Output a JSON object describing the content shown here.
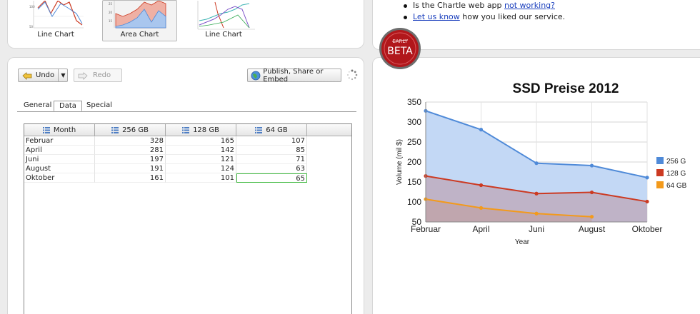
{
  "thumbnails": [
    {
      "label": "Line Chart",
      "selected": false
    },
    {
      "label": "Area Chart",
      "selected": true
    },
    {
      "label": "Line Chart",
      "selected": false
    }
  ],
  "info": {
    "line1_prefix": "Is the Chartle web app ",
    "line1_link": "not working?",
    "line2_link": "Let us know",
    "line2_suffix": " how you liked our service."
  },
  "badge": {
    "top": "EARLY",
    "main": "BETA"
  },
  "toolbar": {
    "undo_label": "Undo",
    "redo_label": "Redo",
    "publish_label": "Publish, Share or Embed",
    "undo_icon": "undo-arrow-icon",
    "redo_icon": "redo-arrow-icon",
    "publish_icon": "globe-icon",
    "spinner_icon": "loading-spinner-icon"
  },
  "tabs": [
    {
      "label": "General",
      "active": false
    },
    {
      "label": "Data",
      "active": true
    },
    {
      "label": "Special",
      "active": false
    }
  ],
  "table": {
    "columns": [
      "Month",
      "256 GB",
      "128 GB",
      "64 GB"
    ],
    "rows": [
      [
        "Februar",
        "328",
        "165",
        "107"
      ],
      [
        "April",
        "281",
        "142",
        "85"
      ],
      [
        "Juni",
        "197",
        "121",
        "71"
      ],
      [
        "August",
        "191",
        "124",
        "63"
      ],
      [
        "Oktober",
        "161",
        "101",
        "65"
      ]
    ]
  },
  "colors": {
    "series_256": "#4f8ad8",
    "series_128": "#cc3a22",
    "series_64": "#f39a1b",
    "link": "#1a3fbd",
    "selection": "#3fba3f"
  },
  "chart_data": {
    "type": "area",
    "title": "SSD Preise 2012",
    "xlabel": "Year",
    "ylabel": "Volume (mil $)",
    "categories": [
      "Februar",
      "April",
      "Juni",
      "August",
      "Oktober"
    ],
    "ylim": [
      50,
      350
    ],
    "yticks": [
      50,
      100,
      150,
      200,
      250,
      300,
      350
    ],
    "grid": true,
    "legend_position": "right",
    "series": [
      {
        "name": "256 GB",
        "legend_label": "256 G",
        "values": [
          328,
          281,
          197,
          191,
          161
        ]
      },
      {
        "name": "128 GB",
        "legend_label": "128 G",
        "values": [
          165,
          142,
          121,
          124,
          101
        ]
      },
      {
        "name": "64 GB",
        "legend_label": "64 GB",
        "values": [
          107,
          85,
          71,
          63,
          null
        ]
      }
    ]
  }
}
